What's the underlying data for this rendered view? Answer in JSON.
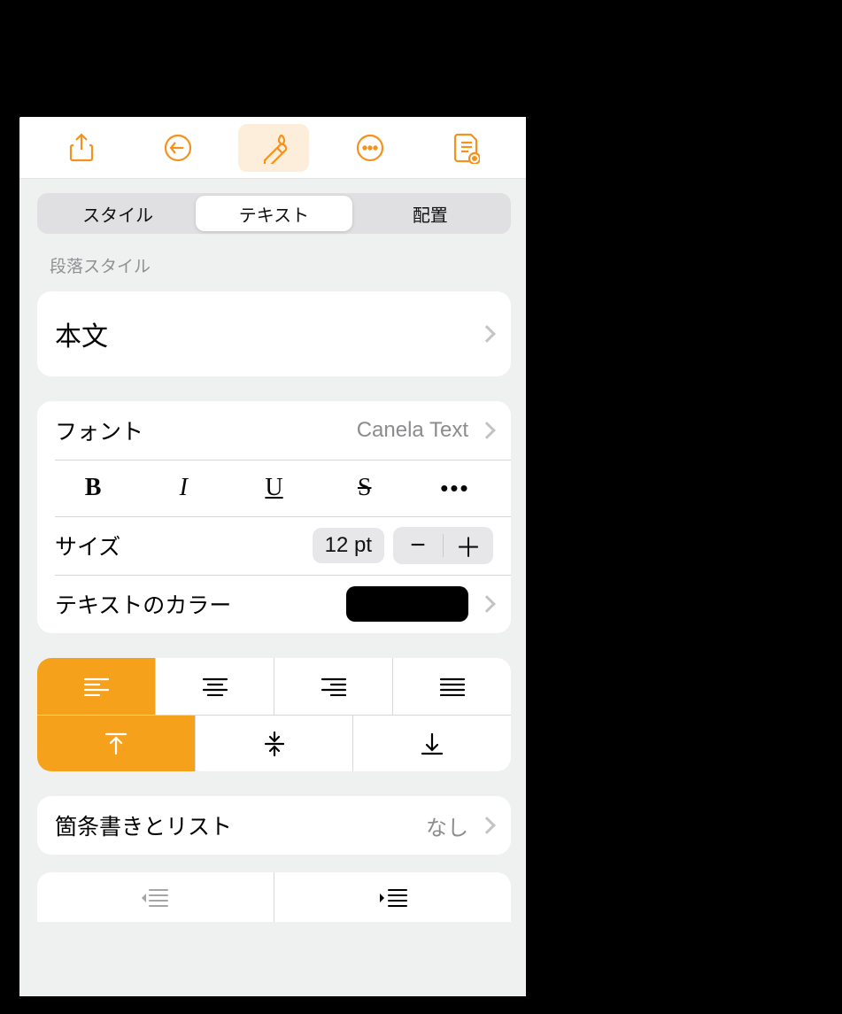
{
  "toolbar": {
    "icons": [
      "share-icon",
      "undo-icon",
      "format-icon",
      "more-icon",
      "document-icon"
    ],
    "active_index": 2
  },
  "tabs": {
    "items": [
      "スタイル",
      "テキスト",
      "配置"
    ],
    "active_index": 1
  },
  "paragraph_style": {
    "header": "段落スタイル",
    "value": "本文"
  },
  "font": {
    "label": "フォント",
    "value": "Canela Text"
  },
  "format_buttons": {
    "bold": "B",
    "italic": "I",
    "underline": "U",
    "strike": "S",
    "more": "•••"
  },
  "size": {
    "label": "サイズ",
    "value": "12 pt"
  },
  "text_color": {
    "label": "テキストのカラー",
    "value_hex": "#000000"
  },
  "alignment": {
    "horizontal": [
      "left",
      "center",
      "right",
      "justify"
    ],
    "horizontal_active": 0,
    "vertical": [
      "top",
      "middle",
      "bottom"
    ],
    "vertical_active": 0
  },
  "bullets": {
    "label": "箇条書きとリスト",
    "value": "なし"
  },
  "indent": {
    "decrease_enabled": false,
    "increase_enabled": true
  }
}
